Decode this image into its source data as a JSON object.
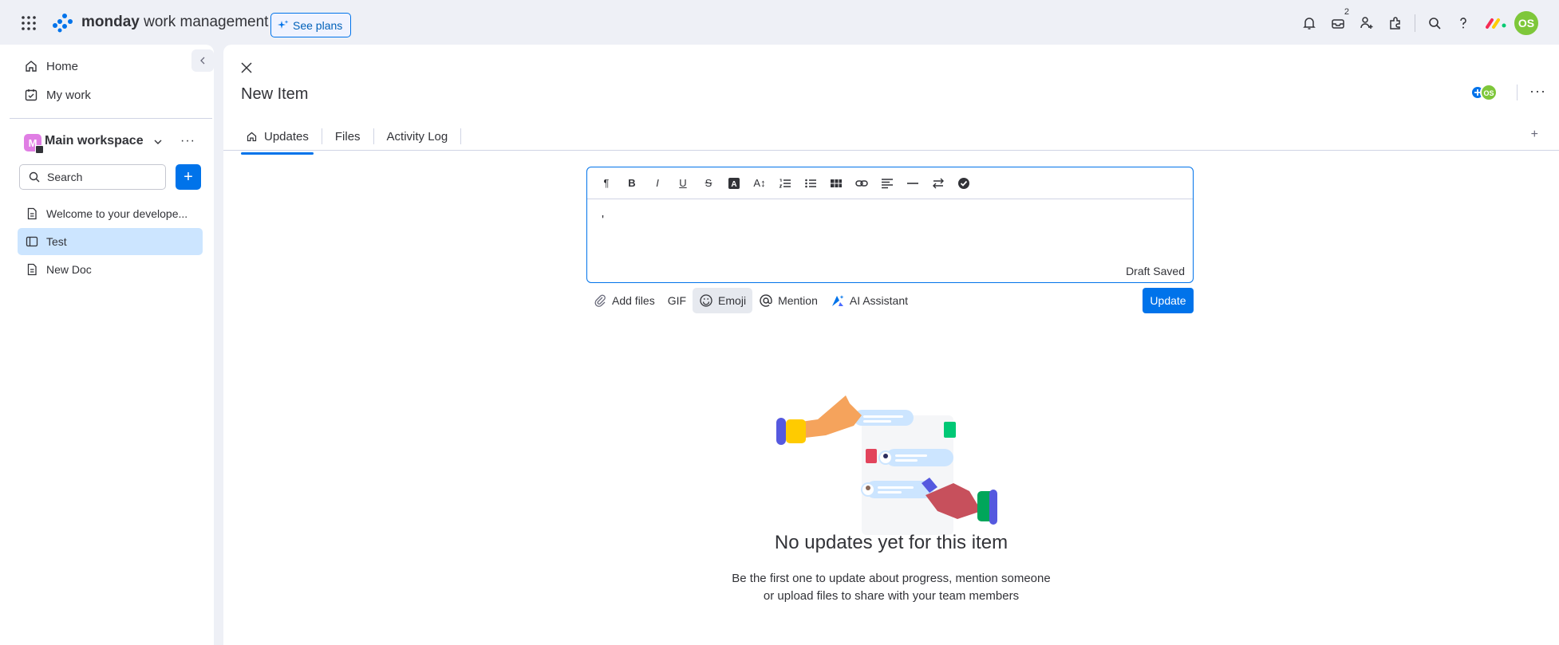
{
  "topbar": {
    "brand_bold": "monday",
    "brand_rest": " work management",
    "see_plans": "See plans",
    "inbox_count": "2",
    "avatar_initials": "OS"
  },
  "sidebar": {
    "home": "Home",
    "my_work": "My work",
    "workspace_initial": "M",
    "workspace_name": "Main workspace",
    "more": "···",
    "search_placeholder": "Search",
    "add": "+",
    "items": [
      {
        "label": "Welcome to your develope...",
        "icon": "doc-icon"
      },
      {
        "label": "Test",
        "icon": "board-icon"
      },
      {
        "label": "New Doc",
        "icon": "doc-icon"
      }
    ]
  },
  "item": {
    "title": "New Item",
    "avatar_initials": "OS",
    "more": "···",
    "tabs": [
      "Updates",
      "Files",
      "Activity Log"
    ],
    "tab_plus": "+"
  },
  "editor": {
    "toolbar": {
      "paragraph": "¶",
      "bold": "B",
      "italic": "I",
      "underline": "U",
      "strike": "S",
      "text_color": "A",
      "font_size": "A↕"
    },
    "caret": "'",
    "draft_status": "Draft Saved",
    "actions": {
      "add_files": "Add files",
      "gif": "GIF",
      "emoji": "Emoji",
      "mention": "Mention",
      "ai": "AI Assistant"
    },
    "update_button": "Update"
  },
  "empty_state": {
    "title": "No updates yet for this item",
    "line1": "Be the first one to update about progress, mention someone",
    "line2": "or upload files to share with your team members"
  },
  "colors": {
    "accent": "#0073ea",
    "active_item": "#cce5ff",
    "avatar": "#7ec73a",
    "workspace": "#e07ee4"
  }
}
